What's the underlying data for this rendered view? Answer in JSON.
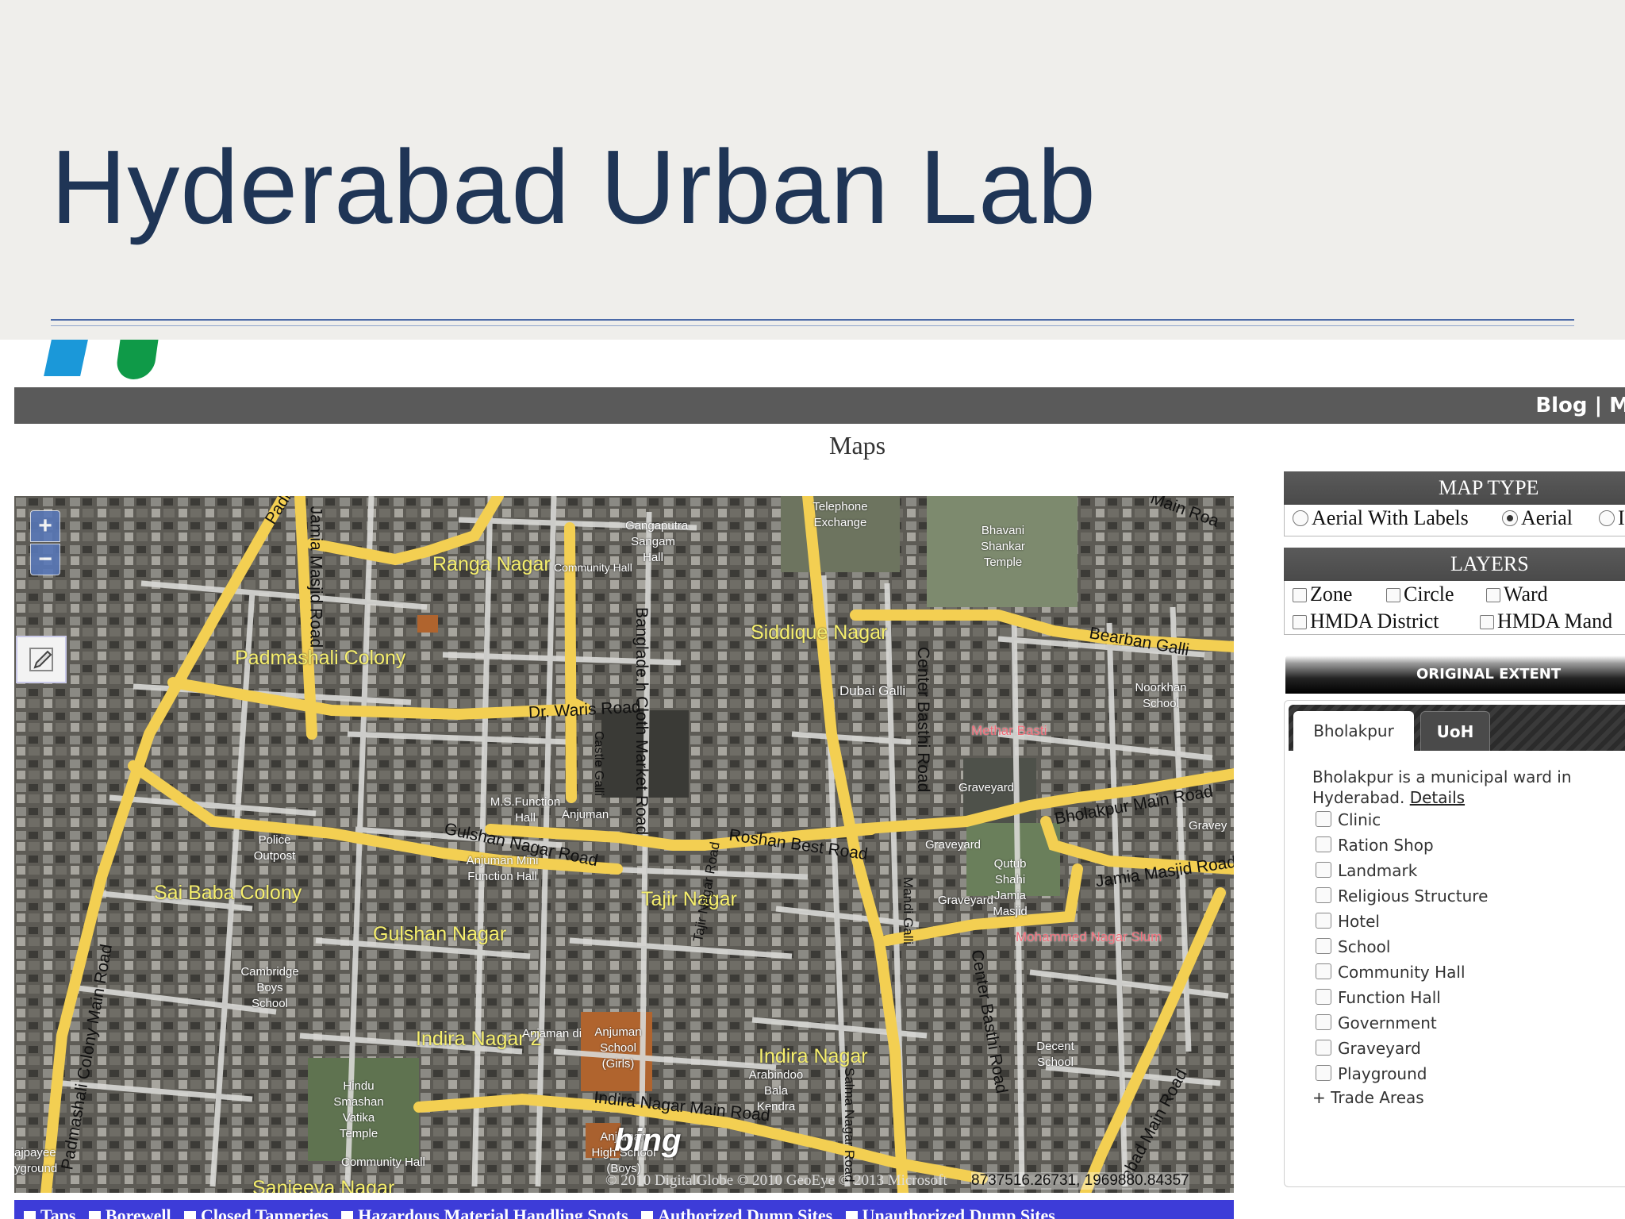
{
  "slide": {
    "title": "Hyderabad Urban Lab"
  },
  "nav": {
    "links": "Blog | M"
  },
  "page": {
    "heading": "Maps"
  },
  "map": {
    "zoom_in": "+",
    "zoom_out": "−",
    "edit_tool_icon": "pencil-icon",
    "labels": {
      "padi": "Padi",
      "jamia_masjid_road_v": "Jamia Masjid Road",
      "ranga_nagar": "Ranga Nagar",
      "community_hall_1": "Community Hall",
      "gangaputra": "Gangaputra Sangam Hall",
      "banglade": "Banglade.h Cloth Market Road",
      "telephone": "Telephone Exchange",
      "bhavani": "Bhavani Shankar Temple",
      "main_roa": "Main Roa",
      "siddique": "Siddique Nagar",
      "bearban": "Bearban Galli",
      "padmashali_colony": "Padmashali Colony",
      "dubai": "Dubai Galli",
      "center_basthi_1": "Center Basthi Road",
      "noorkhan": "Noorkhan School",
      "dr_waris": "Dr. Waris Road",
      "castle": "Castle Galli",
      "methar": "Methar Basti",
      "ms_function": "M.S.Function Hall",
      "anjuman": "Anjuman",
      "graveyard_1": "Graveyard",
      "bholakpur_main": "Bholakpur Main Road",
      "gravey": "Gravey",
      "police": "Police Outpost",
      "gulshan_road": "Gulshan Nagar Road",
      "roshan": "Roshan Best Road",
      "graveyard_2": "Graveyard",
      "anjuman_mini": "Anjuman Mini Function Hall",
      "qutub": "Qutub Shahi Jamia Masjid",
      "jamia_masjid_road_h": "Jamia Masjid Road",
      "sai_baba": "Sai Baba Colony",
      "tajir_nagar": "Tajir Nagar",
      "graveyard_3": "Graveyard",
      "mandi": "Mandi Galli",
      "gulshan_nagar": "Gulshan Nagar",
      "mohammed": "Mohammed Nagar Slum",
      "cambridge": "Cambridge Boys School",
      "padmashali_main": "Padmashali Colony Main Road",
      "tajir_road": "Tajir Nagar Road",
      "center_basthi_2": "Center Basthi Road",
      "indira_2": "Indira Nagar 2",
      "anjuman_girls": "Anjuman School (Girls)",
      "anjaman": "Anjaman di",
      "indira": "Indira Nagar",
      "arabindoo": "Arabindoo Bala Kendra",
      "decent": "Decent School",
      "hindu": "Hindu Smashan Vatika Temple",
      "indira_main": "Indira Nagar Main Road",
      "ishrabad": "abad Main Road",
      "anjuman_boys": "Anjuman High School (Boys)",
      "salma": "Salma Nagar Road",
      "vajpayee": "ajpayee yground",
      "community_2": "Community Hall",
      "sanjeeva": "Sanjeeva Nagar"
    },
    "attribution_brand": "bing",
    "copyright": "© 2010 DigitalGlobe © 2010 GeoEye © 2013 Microsoft",
    "coords": "8737516.26731, 1969880.84357"
  },
  "legend": {
    "items": [
      "Taps",
      "Borewell",
      "Closed Tanneries",
      "Hazardous Material Handling Spots",
      "Authorized Dump Sites",
      "Unauthorized Dump Sites"
    ]
  },
  "panel": {
    "map_type_header": "MAP TYPE",
    "map_type_options": [
      {
        "label": "Aerial With Labels",
        "selected": false
      },
      {
        "label": "Aerial",
        "selected": true
      },
      {
        "label": "I",
        "selected": false
      }
    ],
    "layers_header": "LAYERS",
    "layers": [
      "Zone",
      "Circle",
      "Ward",
      "HMDA District",
      "HMDA Mand"
    ],
    "original_extent": "ORIGINAL EXTENT",
    "tabs": [
      "Bholakpur",
      "UoH"
    ],
    "ward_description": "Bholakpur is a municipal ward in Hyderabad.",
    "details_link": "Details",
    "amenities": [
      "Clinic",
      "Ration Shop",
      "Landmark",
      "Religious Structure",
      "Hotel",
      "School",
      "Community Hall",
      "Function Hall",
      "Government",
      "Graveyard",
      "Playground"
    ],
    "trade_areas": "+ Trade Areas"
  },
  "colors": {
    "title": "#1f3556",
    "navbar": "#5a5a5a",
    "road": "#f3cf52",
    "legend_bg": "#3d3cd8"
  }
}
